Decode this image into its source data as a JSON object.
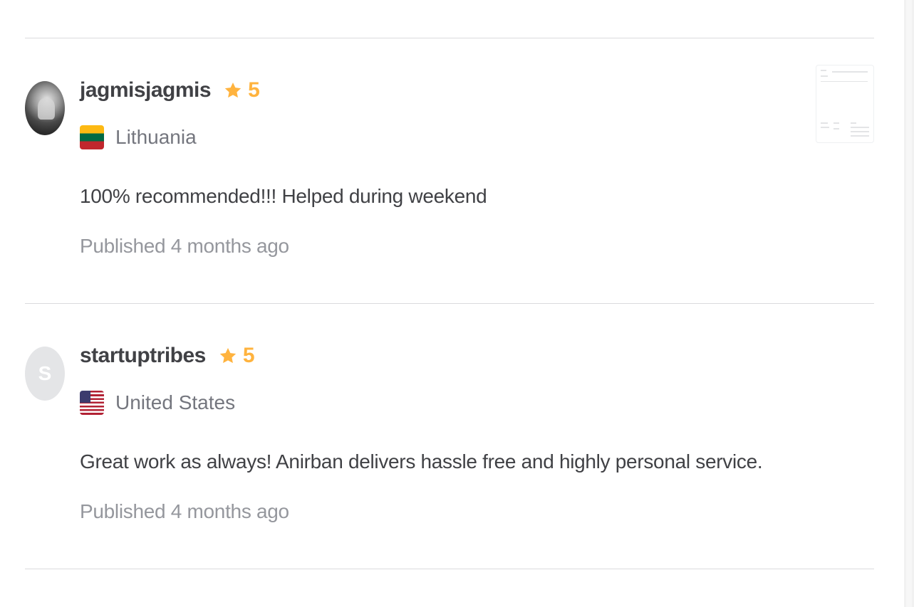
{
  "reviews": [
    {
      "username": "jagmisjagmis",
      "rating": "5",
      "country": "Lithuania",
      "flag_icon": "flag-lithuania-icon",
      "text": "100% recommended!!! Helped during weekend",
      "published": "Published 4 months ago",
      "avatar_type": "photo",
      "has_attachment": true
    },
    {
      "username": "startuptribes",
      "rating": "5",
      "country": "United States",
      "flag_icon": "flag-united-states-icon",
      "text": "Great work as always! Anirban delivers hassle free and highly personal service.",
      "published": "Published 4 months ago",
      "avatar_type": "initial",
      "avatar_initial": "S",
      "has_attachment": false
    }
  ],
  "colors": {
    "star": "#ffb33e",
    "text": "#404145",
    "muted": "#95979d",
    "divider": "#dadbdd"
  }
}
